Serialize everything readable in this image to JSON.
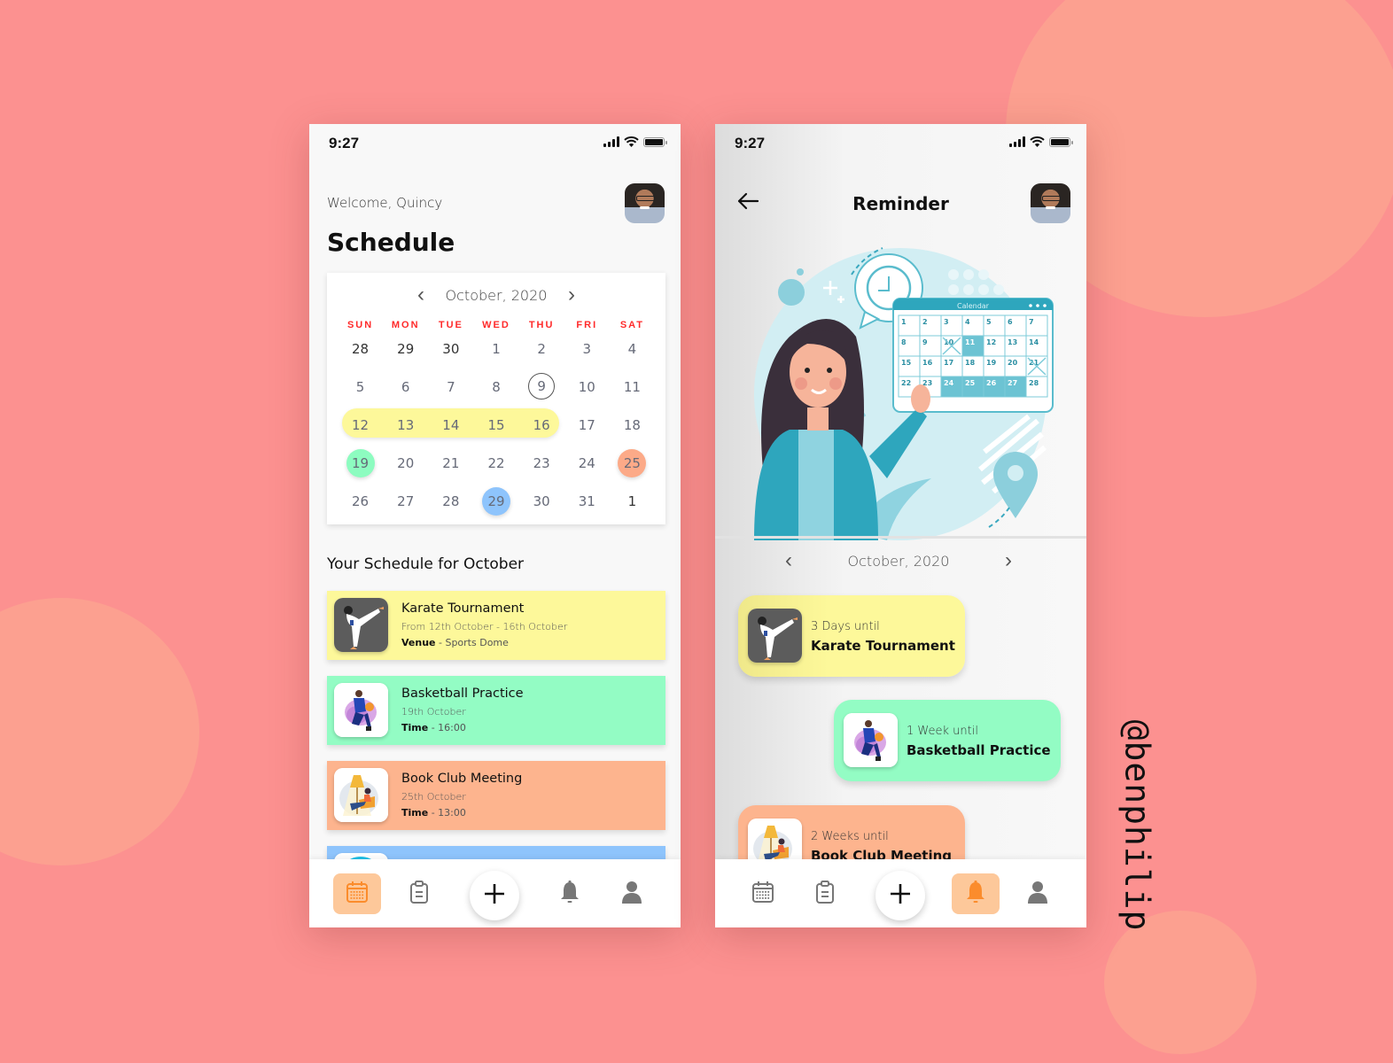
{
  "background": {
    "color": "#fc9190",
    "circle_color": "#fca090"
  },
  "watermark": "@benphilip",
  "colors": {
    "yellow": "#fdf89a",
    "green": "#93fcc4",
    "orange": "#fdb48e",
    "blue": "#8ec4fc",
    "weekday_red": "#ff2a2a",
    "tab_active": "#fdc89a",
    "tab_active_icon": "#fb8c2c"
  },
  "status_bar": {
    "time": "9:27"
  },
  "schedule_screen": {
    "welcome": "Welcome, Quincy",
    "title": "Schedule",
    "calendar": {
      "month_label": "October, 2020",
      "prev_icon": "chevron-left-icon",
      "next_icon": "chevron-right-icon",
      "weekdays": [
        "SUN",
        "MON",
        "TUE",
        "WED",
        "THU",
        "FRI",
        "SAT"
      ],
      "weeks": [
        [
          "28",
          "29",
          "30",
          "1",
          "2",
          "3",
          "4"
        ],
        [
          "5",
          "6",
          "7",
          "8",
          "9",
          "10",
          "11"
        ],
        [
          "12",
          "13",
          "14",
          "15",
          "16",
          "17",
          "18"
        ],
        [
          "19",
          "20",
          "21",
          "22",
          "23",
          "24",
          "25"
        ],
        [
          "26",
          "27",
          "28",
          "29",
          "30",
          "31",
          "1"
        ]
      ],
      "today": "9",
      "range_highlight": {
        "from": "12",
        "to": "16",
        "event": "Karate Tournament"
      },
      "marked_days": [
        {
          "day": "19",
          "event": "Basketball Practice",
          "color": "green"
        },
        {
          "day": "25",
          "event": "Book Club Meeting",
          "color": "orange"
        },
        {
          "day": "29",
          "event": "",
          "color": "blue"
        }
      ]
    },
    "section_title": "Your Schedule for October",
    "events": [
      {
        "title": "Karate Tournament",
        "subtitle": "From 12th October - 16th October",
        "detail_label": "Venue",
        "detail_value": "Sports Dome",
        "color": "#fdf89a",
        "thumb": "karate-icon"
      },
      {
        "title": "Basketball Practice",
        "subtitle": "19th October",
        "detail_label": "Time",
        "detail_value": "16:00",
        "color": "#93fcc4",
        "thumb": "basketball-player-icon"
      },
      {
        "title": "Book Club Meeting",
        "subtitle": "25th October",
        "detail_label": "Time",
        "detail_value": "13:00",
        "color": "#fdb48e",
        "thumb": "reading-icon"
      },
      {
        "title": "",
        "subtitle": "",
        "detail_label": "",
        "detail_value": "",
        "color": "#8ec4fc",
        "thumb": "globe-icon"
      }
    ],
    "tabbar": {
      "items": [
        {
          "icon": "calendar-icon",
          "active": true
        },
        {
          "icon": "clipboard-icon",
          "active": false
        },
        {
          "icon": "plus-icon",
          "active": false
        },
        {
          "icon": "bell-icon",
          "active": false
        },
        {
          "icon": "user-icon",
          "active": false
        }
      ]
    }
  },
  "reminder_screen": {
    "title": "Reminder",
    "back_icon": "arrow-left-icon",
    "illustration": {
      "calendar_title": "Calendar",
      "calendar_days": [
        "1",
        "2",
        "3",
        "4",
        "5",
        "6",
        "7",
        "8",
        "9",
        "10",
        "11",
        "12",
        "13",
        "14",
        "15",
        "16",
        "17",
        "18",
        "19",
        "20",
        "21",
        "22",
        "23",
        "24",
        "25",
        "26",
        "27",
        "28"
      ]
    },
    "month_label": "October, 2020",
    "reminders": [
      {
        "when": "3 Days until",
        "title": "Karate Tournament",
        "color": "#fdf89a",
        "thumb": "karate-icon"
      },
      {
        "when": "1 Week until",
        "title": "Basketball Practice",
        "color": "#93fcc4",
        "thumb": "basketball-player-icon"
      },
      {
        "when": "2 Weeks until",
        "title": "Book Club Meeting",
        "color": "#fdb48e",
        "thumb": "reading-icon"
      }
    ],
    "tabbar": {
      "items": [
        {
          "icon": "calendar-icon",
          "active": false
        },
        {
          "icon": "clipboard-icon",
          "active": false
        },
        {
          "icon": "plus-icon",
          "active": false
        },
        {
          "icon": "bell-icon",
          "active": true
        },
        {
          "icon": "user-icon",
          "active": false
        }
      ]
    }
  }
}
